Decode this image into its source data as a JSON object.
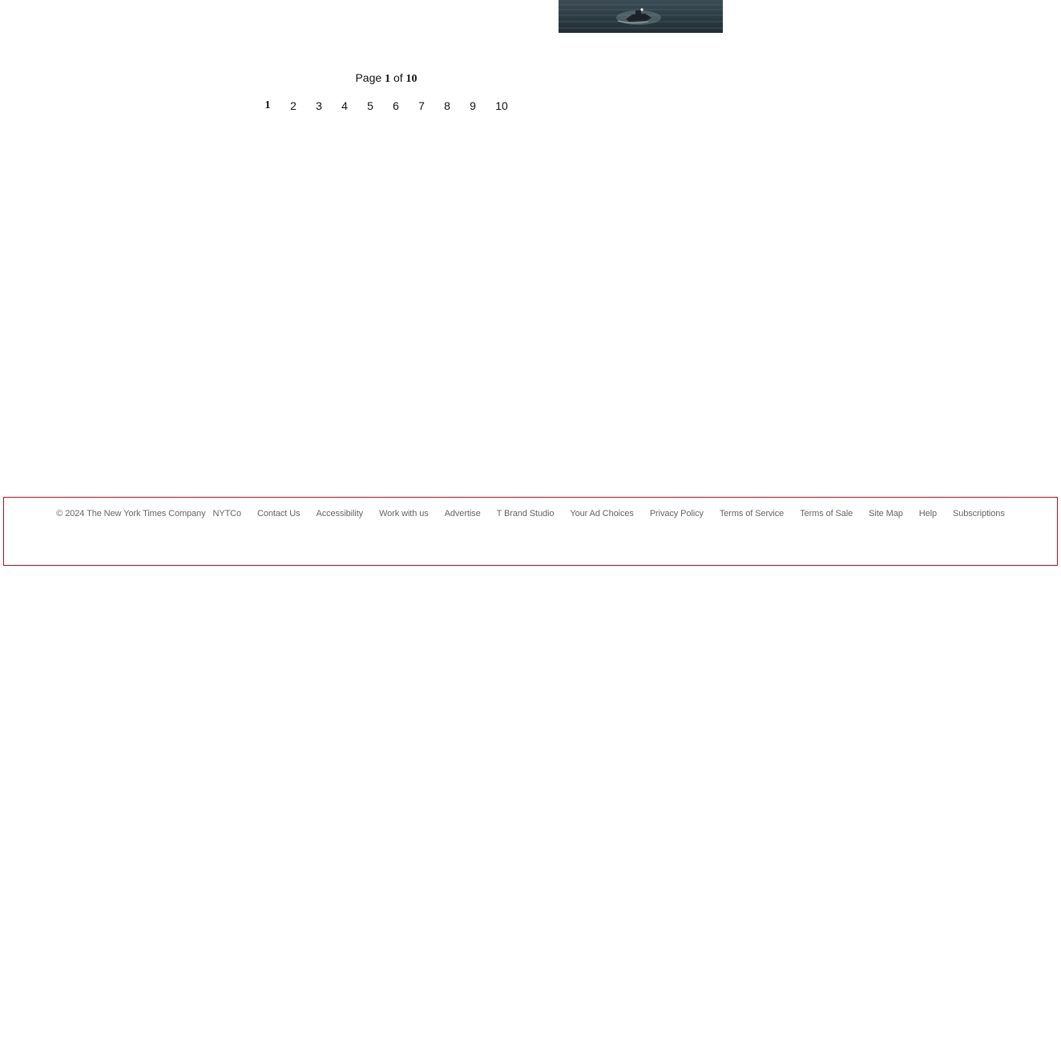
{
  "thumbnail": {
    "icon": "boat-night-photo"
  },
  "pagination": {
    "label_page": "Page",
    "current": "1",
    "label_of": "of",
    "total": "10",
    "pages": [
      "1",
      "2",
      "3",
      "4",
      "5",
      "6",
      "7",
      "8",
      "9",
      "10"
    ]
  },
  "footer": {
    "copyright": "© 2024 The New York Times Company",
    "links": [
      "NYTCo",
      "Contact Us",
      "Accessibility",
      "Work with us",
      "Advertise",
      "T Brand Studio",
      "Your Ad Choices",
      "Privacy Policy",
      "Terms of Service",
      "Terms of Sale",
      "Site Map",
      "Help",
      "Subscriptions"
    ],
    "border_color": "#d0021b"
  }
}
